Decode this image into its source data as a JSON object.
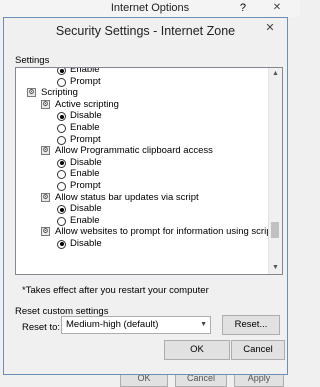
{
  "parent": {
    "title": "Internet Options",
    "help_label": "?",
    "close_label": "✕",
    "ok_label": "OK",
    "cancel_label": "Cancel",
    "apply_label": "Apply"
  },
  "dialog": {
    "title": "Security Settings - Internet Zone",
    "close_label": "✕",
    "settings_label": "Settings",
    "note": "*Takes effect after you restart your computer",
    "reset": {
      "group_label": "Reset custom settings",
      "reset_to_label": "Reset to:",
      "selected": "Medium-high (default)",
      "reset_button": "Reset..."
    },
    "ok_label": "OK",
    "cancel_label": "Cancel"
  },
  "tree": [
    {
      "kind": "radio",
      "label": "Enable",
      "checked": true
    },
    {
      "kind": "radio",
      "label": "Prompt",
      "checked": false
    },
    {
      "kind": "category",
      "label": "Scripting"
    },
    {
      "kind": "setting",
      "label": "Active scripting"
    },
    {
      "kind": "radio",
      "label": "Disable",
      "checked": true
    },
    {
      "kind": "radio",
      "label": "Enable",
      "checked": false
    },
    {
      "kind": "radio",
      "label": "Prompt",
      "checked": false
    },
    {
      "kind": "setting",
      "label": "Allow Programmatic clipboard access"
    },
    {
      "kind": "radio",
      "label": "Disable",
      "checked": true
    },
    {
      "kind": "radio",
      "label": "Enable",
      "checked": false
    },
    {
      "kind": "radio",
      "label": "Prompt",
      "checked": false
    },
    {
      "kind": "setting",
      "label": "Allow status bar updates via script"
    },
    {
      "kind": "radio",
      "label": "Disable",
      "checked": true
    },
    {
      "kind": "radio",
      "label": "Enable",
      "checked": false
    },
    {
      "kind": "setting",
      "label": "Allow websites to prompt for information using scripted windo"
    },
    {
      "kind": "radio",
      "label": "Disable",
      "checked": true
    }
  ],
  "scroll": {
    "thumb_start": 0.78,
    "thumb_size": 0.09
  }
}
